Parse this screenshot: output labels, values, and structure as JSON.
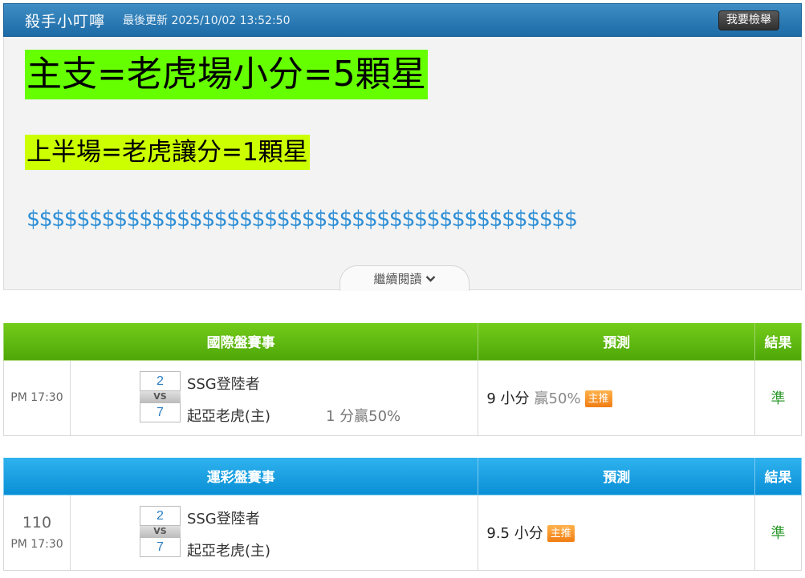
{
  "header": {
    "author": "殺手小叮嚀",
    "updated": "最後更新 2025/10/02 13:52:50",
    "report_label": "我要檢舉"
  },
  "article": {
    "line1": "主支=老虎場小分=5顆星",
    "line2": "上半場=老虎讓分=1顆星",
    "line3": "$$$$$$$$$$$$$$$$$$$$$$$$$$$$$$$$$$$$$$$$$$$$",
    "read_more": "繼續閱讀"
  },
  "tables": [
    {
      "header_event": "國際盤賽事",
      "header_pred": "預測",
      "header_result": "結果",
      "rows": [
        {
          "number": "",
          "time": "PM 17:30",
          "score_home": "2",
          "vs": "VS",
          "score_away": "7",
          "team1": "SSG登陸者",
          "team2": "起亞老虎(主)",
          "handicap": "1 分贏50%",
          "prediction": "9 小分",
          "prediction_pct": "贏50%",
          "badge": "主推",
          "result": "準"
        }
      ]
    },
    {
      "header_event": "運彩盤賽事",
      "header_pred": "預測",
      "header_result": "結果",
      "rows": [
        {
          "number": "110",
          "time": "PM 17:30",
          "score_home": "2",
          "vs": "VS",
          "score_away": "7",
          "team1": "SSG登陸者",
          "team2": "起亞老虎(主)",
          "prediction": "9.5 小分",
          "badge": "主推",
          "result": "準"
        }
      ]
    }
  ],
  "colors": {
    "header_blue": "#1d6aa6",
    "highlight_green": "#66ff00",
    "highlight_yellow": "#ccff00",
    "dollar_blue": "#2f8fd6",
    "table_green": "#4ea708",
    "table_blue": "#0a8fd6",
    "badge_orange": "#f07d12",
    "result_green": "#2c9a2c"
  }
}
